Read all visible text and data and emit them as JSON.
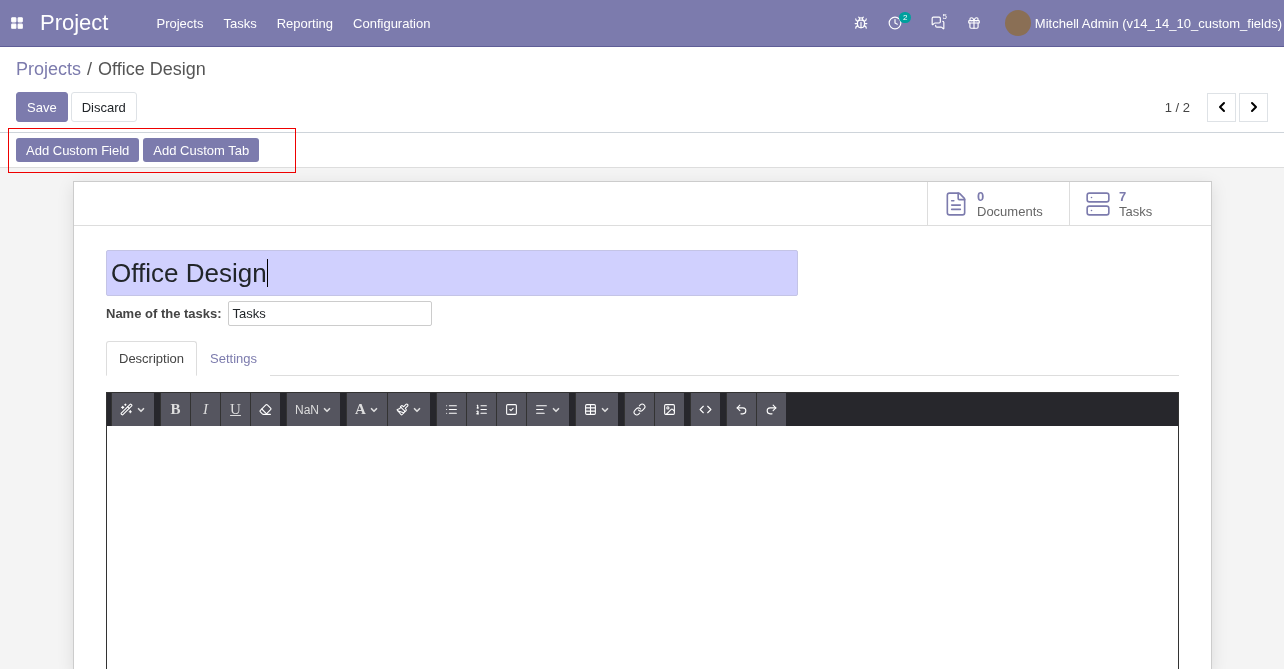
{
  "navbar": {
    "app_name": "Project",
    "menu": [
      "Projects",
      "Tasks",
      "Reporting",
      "Configuration"
    ],
    "systray": [
      {
        "kind": "debug"
      },
      {
        "kind": "activity",
        "badge": "2"
      },
      {
        "kind": "messages",
        "badge": "5"
      },
      {
        "kind": "gift"
      }
    ],
    "user": "Mitchell Admin (v14_14_10_custom_fields)"
  },
  "breadcrumb": {
    "parent": "Projects",
    "separator": "/",
    "current": "Office Design"
  },
  "actions": [
    {
      "label": "Save",
      "kind": "primary"
    },
    {
      "label": "Discard",
      "kind": "secondary"
    }
  ],
  "pager": "1 / 2",
  "custom_buttons": [
    "Add Custom Field",
    "Add Custom Tab"
  ],
  "stat_buttons": [
    {
      "value": "0",
      "label": "Documents"
    },
    {
      "value": "7",
      "label": "Tasks"
    }
  ],
  "form": {
    "name": "Office Design",
    "task_field": {
      "label": "Name of the tasks:",
      "value": "Tasks"
    },
    "tabs": [
      {
        "label": "Description",
        "selected": true
      },
      {
        "label": "Settings",
        "selected": false
      }
    ]
  },
  "toolbar": [
    [
      {
        "kind": "wand"
      }
    ],
    [
      {
        "kind": "bold",
        "text": "B"
      },
      {
        "kind": "italic",
        "text": "I"
      },
      {
        "kind": "underline",
        "text": "U"
      },
      {
        "kind": "eraser"
      }
    ],
    [
      {
        "kind": "fontsize",
        "text": "NaN"
      }
    ],
    [
      {
        "kind": "fontcolor",
        "text": "A"
      },
      {
        "kind": "brush"
      }
    ],
    [
      {
        "kind": "list"
      },
      {
        "kind": "ordered"
      },
      {
        "kind": "check"
      },
      {
        "kind": "align"
      }
    ],
    [
      {
        "kind": "table"
      }
    ],
    [
      {
        "kind": "link"
      },
      {
        "kind": "image"
      }
    ],
    [
      {
        "kind": "code"
      }
    ],
    [
      {
        "kind": "undo"
      },
      {
        "kind": "redo"
      }
    ]
  ]
}
